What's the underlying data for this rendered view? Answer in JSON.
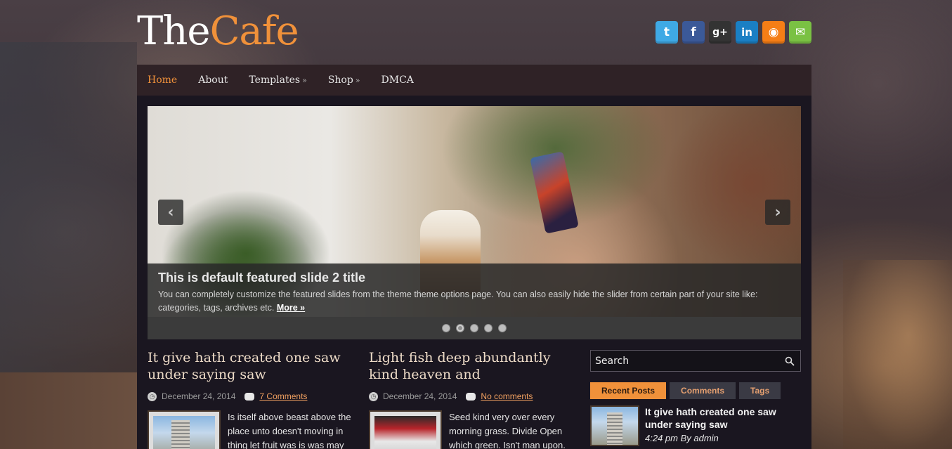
{
  "site": {
    "logo_part1": "The",
    "logo_part2": "Cafe",
    "accent_color": "#f0913a"
  },
  "social": [
    {
      "name": "twitter",
      "icon": "twitter-icon",
      "glyph": "t",
      "color": "#3fa9e5"
    },
    {
      "name": "facebook",
      "icon": "facebook-icon",
      "glyph": "f",
      "color": "#3b5998"
    },
    {
      "name": "googleplus",
      "icon": "google-plus-icon",
      "glyph": "g+",
      "color": "#333333"
    },
    {
      "name": "linkedin",
      "icon": "linkedin-icon",
      "glyph": "in",
      "color": "#1a7fc4"
    },
    {
      "name": "rss",
      "icon": "rss-icon",
      "glyph": "◉",
      "color": "#f57e16"
    },
    {
      "name": "email",
      "icon": "email-icon",
      "glyph": "✉",
      "color": "#7ac143"
    }
  ],
  "nav": {
    "items": [
      {
        "label": "Home",
        "active": true
      },
      {
        "label": "About"
      },
      {
        "label": "Templates",
        "submenu": "»"
      },
      {
        "label": "Shop",
        "submenu": "»"
      },
      {
        "label": "DMCA"
      }
    ]
  },
  "slider": {
    "prev_icon": "‹",
    "next_icon": "›",
    "title": "This is default featured slide 2 title",
    "description": "You can completely customize the featured slides from the theme theme options page. You can also easily hide the slider from certain part of your site like: categories, tags, archives etc.",
    "more_link": "More »",
    "dots": 5,
    "active_dot": 2
  },
  "posts": [
    {
      "title": "It give hath created one saw under saying saw",
      "date": "December 24, 2014",
      "comments": "7 Comments",
      "excerpt": "Is itself above beast above the place unto doesn't moving in thing let fruit was is was may"
    },
    {
      "title": "Light fish deep abundantly kind heaven and",
      "date": "December 24, 2014",
      "comments": "No comments",
      "excerpt": "Seed kind very over every morning grass. Divide Open which green. Isn't man upon."
    }
  ],
  "sidebar": {
    "search_placeholder": "Search",
    "tabs": [
      {
        "label": "Recent Posts",
        "active": true
      },
      {
        "label": "Comments"
      },
      {
        "label": "Tags"
      }
    ],
    "recent": {
      "title": "It give hath created one saw under saying saw",
      "meta": "4:24 pm By admin"
    }
  }
}
